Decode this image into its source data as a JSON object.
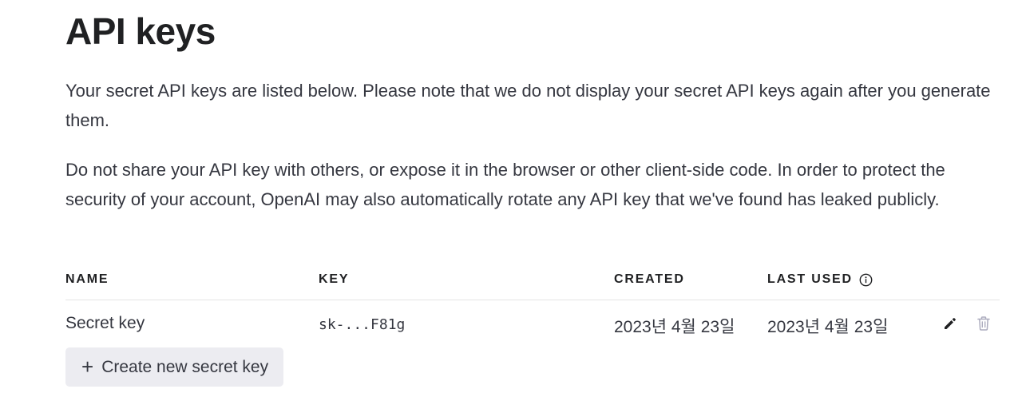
{
  "page": {
    "title": "API keys",
    "intro": "Your secret API keys are listed below. Please note that we do not display your secret API keys again after you generate them.",
    "warning": "Do not share your API key with others, or expose it in the browser or other client-side code. In order to protect the security of your account, OpenAI may also automatically rotate any API key that we've found has leaked publicly."
  },
  "table": {
    "headers": {
      "name": "NAME",
      "key": "KEY",
      "created": "CREATED",
      "last_used": "LAST USED"
    },
    "rows": [
      {
        "name": "Secret key",
        "key": "sk-...F81g",
        "created": "2023년 4월 23일",
        "last_used": "2023년 4월 23일"
      }
    ]
  },
  "actions": {
    "create_label": "Create new secret key",
    "create_icon": "plus"
  },
  "icons": {
    "info": "info-icon",
    "edit": "pencil-icon",
    "delete": "trash-icon"
  },
  "colors": {
    "text": "#202123",
    "button_bg": "#ececf1",
    "muted_icon": "#acacbe"
  }
}
